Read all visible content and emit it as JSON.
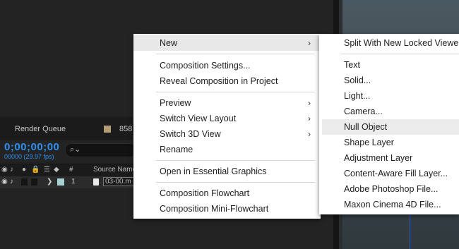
{
  "timeline": {
    "render_queue_tab": "Render Queue",
    "comp_tab": "858",
    "timecode": "0;00;00;00",
    "frames": "00000 (29.97 fps)",
    "search_icon": "search-icon",
    "col_hash": "#",
    "col_source": "Source Name",
    "row_number": "1",
    "row_source": "03-00.m"
  },
  "main_menu": {
    "new": "New",
    "comp_settings": "Composition Settings...",
    "reveal_comp": "Reveal Composition in Project",
    "preview": "Preview",
    "switch_view_layout": "Switch View Layout",
    "switch_3d_view": "Switch 3D View",
    "rename": "Rename",
    "open_essential": "Open in Essential Graphics",
    "comp_flowchart": "Composition Flowchart",
    "comp_mini_flowchart": "Composition Mini-Flowchart"
  },
  "sub_menu": {
    "split": "Split With New Locked Viewe",
    "text": "Text",
    "solid": "Solid...",
    "light": "Light...",
    "camera": "Camera...",
    "null_object": "Null Object",
    "shape_layer": "Shape Layer",
    "adjustment_layer": "Adjustment Layer",
    "content_aware": "Content-Aware Fill Layer...",
    "photoshop_file": "Adobe Photoshop File...",
    "cinema4d_file": "Maxon Cinema 4D File..."
  }
}
